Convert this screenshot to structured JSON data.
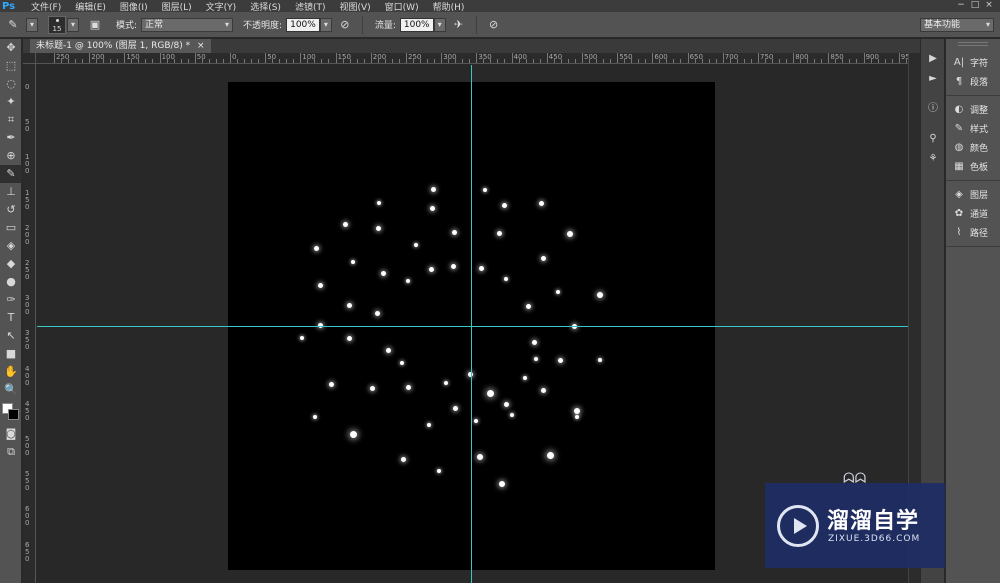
{
  "app": {
    "logo": "Ps"
  },
  "menu": [
    "文件(F)",
    "编辑(E)",
    "图像(I)",
    "图层(L)",
    "文字(Y)",
    "选择(S)",
    "滤镜(T)",
    "视图(V)",
    "窗口(W)",
    "帮助(H)"
  ],
  "window_controls": [
    "−",
    "□",
    "×"
  ],
  "options_bar": {
    "tool_icon": "brush-icon",
    "brush_size": "15",
    "mode_label": "模式:",
    "mode_value": "正常",
    "opacity_label": "不透明度:",
    "opacity_value": "100%",
    "flow_label": "流量:",
    "flow_value": "100%",
    "workspace": "基本功能"
  },
  "document": {
    "tab_title": "未标题-1 @ 100% (图层 1, RGB/8) *",
    "tab_close": "×"
  },
  "ruler_h_labels": [
    "250",
    "200",
    "150",
    "100",
    "50",
    "0",
    "50",
    "100",
    "150",
    "200",
    "250",
    "300",
    "350",
    "400",
    "450",
    "500",
    "550",
    "600",
    "650",
    "700",
    "750",
    "800",
    "850",
    "900",
    "950"
  ],
  "ruler_v_labels": [
    "0",
    "5 0",
    "1 0 0",
    "1 5 0",
    "2 0 0",
    "2 5 0",
    "3 0 0",
    "3 5 0",
    "4 0 0",
    "4 5 0",
    "5 0 0",
    "5 5 0",
    "6 0 0",
    "6 5 0"
  ],
  "tools": [
    "move-icon",
    "marquee-icon",
    "lasso-icon",
    "magic-wand-icon",
    "crop-icon",
    "eyedropper-icon",
    "healing-brush-icon",
    "brush-icon",
    "clone-stamp-icon",
    "history-brush-icon",
    "eraser-icon",
    "paint-bucket-icon",
    "blur-icon",
    "dodge-icon",
    "pen-icon",
    "type-icon",
    "path-selection-icon",
    "rectangle-icon",
    "hand-icon",
    "zoom-icon"
  ],
  "tool_glyphs": [
    "✥",
    "⬚",
    "◌",
    "✦",
    "⌗",
    "✒",
    "⊕",
    "✎",
    "⊥",
    "↺",
    "▭",
    "◈",
    "◆",
    "●",
    "✑",
    "T",
    "↖",
    "■",
    "✋",
    "🔍"
  ],
  "panels": [
    {
      "icon": "character-icon",
      "glyph": "A|",
      "label": "字符"
    },
    {
      "icon": "paragraph-icon",
      "glyph": "¶",
      "label": "段落"
    },
    {
      "icon": "adjustments-icon",
      "glyph": "◐",
      "label": "调整"
    },
    {
      "icon": "styles-icon",
      "glyph": "✎",
      "label": "样式"
    },
    {
      "icon": "color-icon",
      "glyph": "◍",
      "label": "颜色"
    },
    {
      "icon": "swatches-icon",
      "glyph": "▦",
      "label": "色板"
    },
    {
      "icon": "layers-icon",
      "glyph": "◈",
      "label": "图层"
    },
    {
      "icon": "channels-icon",
      "glyph": "✿",
      "label": "通道"
    },
    {
      "icon": "paths-icon",
      "glyph": "⌇",
      "label": "路径"
    }
  ],
  "watermark": {
    "title": "溜溜自学",
    "url": "ZIXUE.3D66.COM"
  },
  "colors": {
    "guide": "#38c6c6",
    "foreground": "#ffffff",
    "background": "#000000",
    "accent": "#31a8ff"
  }
}
